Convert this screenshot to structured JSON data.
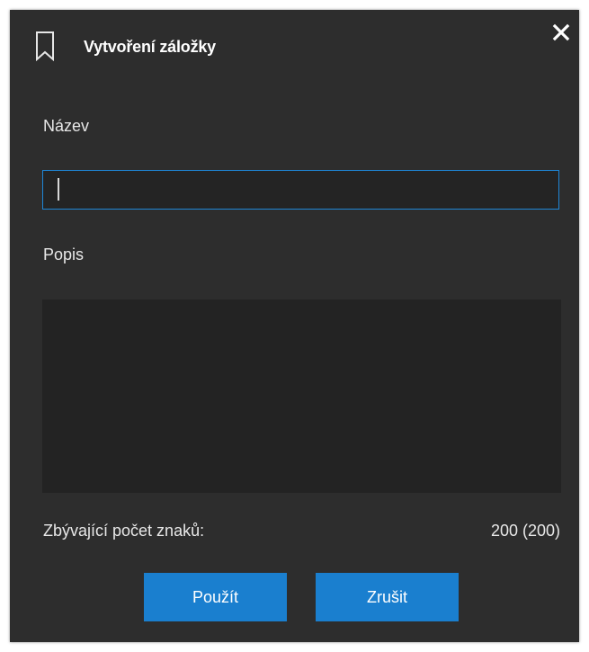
{
  "dialog": {
    "title": "Vytvoření záložky",
    "title_icon": "bookmark-icon",
    "close_icon": "close-icon",
    "colors": {
      "background": "#2d2d2d",
      "input_background": "#242424",
      "accent": "#1a7fcf",
      "focus_border": "#1e86d6",
      "text": "#e8e8e8"
    }
  },
  "form": {
    "name_label": "Název",
    "name_value": "",
    "description_label": "Popis",
    "description_value": "",
    "remaining_label": "Zbývající počet znaků:",
    "remaining_value": "200 (200)"
  },
  "buttons": {
    "apply_label": "Použít",
    "cancel_label": "Zrušit"
  }
}
